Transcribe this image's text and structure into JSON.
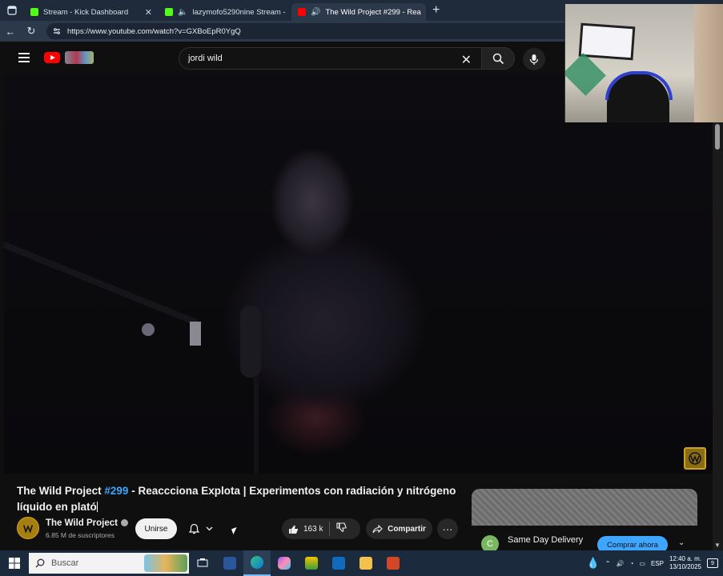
{
  "browser": {
    "tabs": [
      {
        "label": "Stream - Kick Dashboard",
        "favicon_color": "#53fc18",
        "active": false
      },
      {
        "label": "lazymofo5290nine Stream -",
        "favicon_color": "#53fc18",
        "active": false
      },
      {
        "label": "The Wild Project #299 - Rea",
        "favicon_color": "#ff0000",
        "active": true
      }
    ],
    "new_tab": "+",
    "url": "https://www.youtube.com/watch?v=GXBoEpR0YgQ"
  },
  "youtube": {
    "search_value": "jordi wild",
    "video": {
      "title_prefix": "The Wild Project ",
      "title_tag": "#299",
      "title_rest": " - Reaccciona Explota | Experimentos con radiación y nitrógeno líquido en plató"
    },
    "channel": {
      "name": "The Wild Project",
      "subscribers": "6.85 M de suscriptores",
      "join_label": "Unirse"
    },
    "likes": "163 k",
    "share_label": "Compartir",
    "more_label": "···",
    "ad": {
      "avatar_letter": "C",
      "title": "Same Day Delivery",
      "button": "Comprar ahora"
    }
  },
  "taskbar": {
    "search_placeholder": "Buscar",
    "language": "ESP",
    "time": "12:40 a. m.",
    "date": "13/10/2025",
    "notifications": "9"
  },
  "colors": {
    "youtube_red": "#ff0000",
    "link_blue": "#3ea6ff",
    "kick_green": "#53fc18"
  }
}
